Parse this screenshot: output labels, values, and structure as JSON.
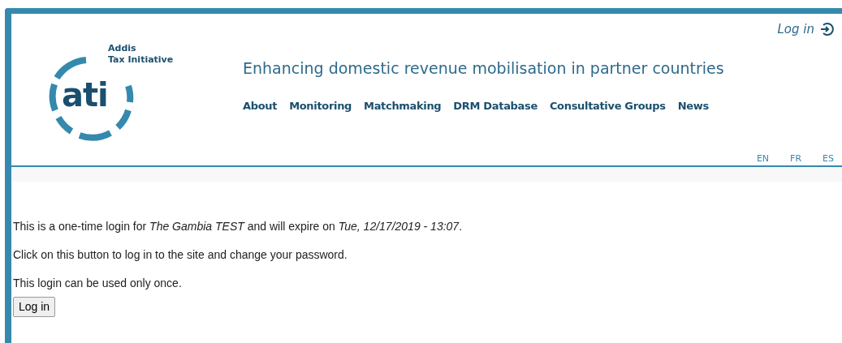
{
  "header": {
    "logo": {
      "mark": "ati",
      "name_lines": [
        "Addis",
        "Tax Initiative"
      ]
    },
    "login_link": "Log in",
    "tagline": "Enhancing domestic revenue mobilisation in partner countries",
    "nav": [
      "About",
      "Monitoring",
      "Matchmaking",
      "DRM Database",
      "Consultative Groups",
      "News"
    ],
    "languages": [
      "EN",
      "FR",
      "ES"
    ]
  },
  "content": {
    "paragraphs": [
      "This is a one-time login for *The Gambia TEST* and will expire on *Tue, 12/17/2019 - 13:07*.",
      "Click on this button to log in to the site and change your password.",
      "This login can be used only once."
    ],
    "button": "Log in"
  }
}
